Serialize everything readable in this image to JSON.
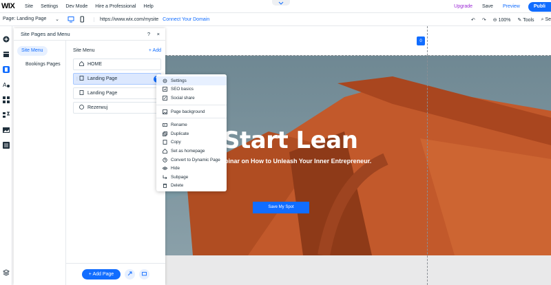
{
  "topbar": {
    "logo": "WIX",
    "menu": [
      "Site",
      "Settings",
      "Dev Mode",
      "Hire a Professional",
      "Help"
    ],
    "upgrade": "Upgrade",
    "save": "Save",
    "preview": "Preview",
    "publish": "Publi"
  },
  "toolbar": {
    "page_label": "Page: Landing Page",
    "url": "https://www.wix.com/mysite",
    "connect": "Connect Your Domain",
    "zoom": "100%",
    "tools": "Tools",
    "search_fragment": "Se"
  },
  "panel": {
    "title": "Site Pages and Menu",
    "help": "?",
    "close": "×",
    "left_items": [
      "Site Menu",
      "Bookings Pages"
    ],
    "site_menu_label": "Site Menu",
    "add_label": "+ Add",
    "pages": [
      "HOME",
      "Landing Page",
      "Landing Page",
      "Rezerwuj"
    ],
    "add_page_button": "+ Add Page"
  },
  "canvas": {
    "cart_count": "0",
    "hero_title": "Start Lean",
    "hero_subtitle": "binar on How to Unleash Your Inner Entrepreneur.",
    "hero_button": "Save My Spot"
  },
  "context_menu": {
    "group1": [
      "Settings",
      "SEO basics",
      "Social share"
    ],
    "group2": [
      "Page background"
    ],
    "group3": [
      "Rename",
      "Duplicate",
      "Copy",
      "Set as homepage",
      "Convert to Dynamic Page",
      "Hide",
      "Subpage",
      "Delete"
    ]
  },
  "colors": {
    "accent": "#116dff",
    "upgrade": "#9a27d5",
    "hero_orange": "#c0582a"
  }
}
